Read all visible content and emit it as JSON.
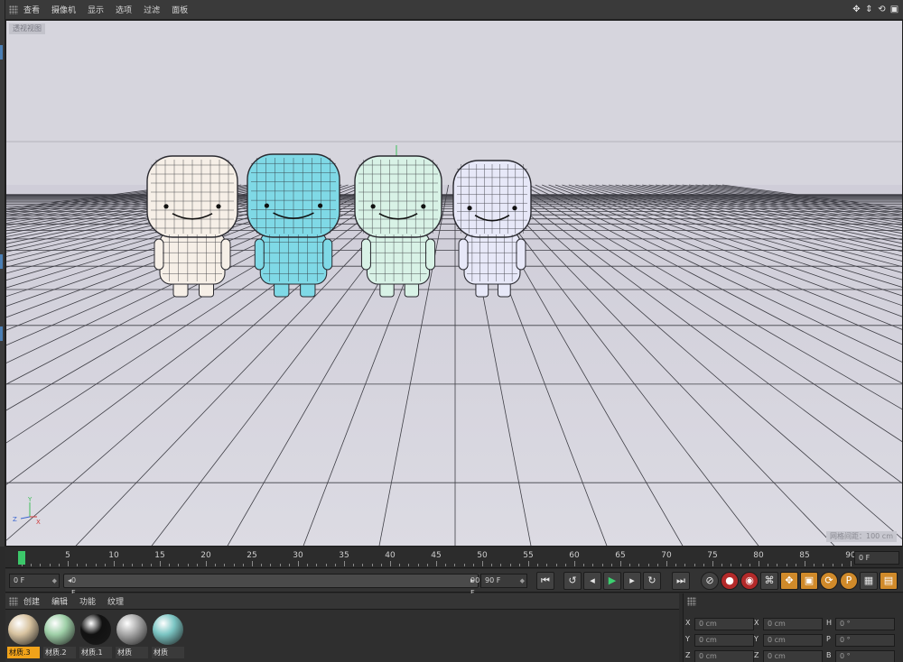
{
  "viewport": {
    "menu": [
      "查看",
      "摄像机",
      "显示",
      "选项",
      "过滤",
      "面板"
    ],
    "label": "透视视图",
    "grid_info": "网格间距：100 cm",
    "nav_icons": [
      "move-view-icon",
      "zoom-view-icon",
      "rotate-view-icon",
      "toggle-view-icon"
    ],
    "axis": {
      "x": "X",
      "y": "Y",
      "z": "Z"
    }
  },
  "timeline": {
    "ticks": [
      0,
      5,
      10,
      15,
      20,
      25,
      30,
      35,
      40,
      45,
      50,
      55,
      60,
      65,
      70,
      75,
      80,
      85,
      90
    ],
    "current_frame": 0,
    "end_field": "0 F"
  },
  "transport": {
    "start_field": "0 F",
    "range_start": "0 F",
    "range_end": "90 F",
    "end_field": "90 F",
    "buttons": [
      "go-start",
      "prev-key",
      "prev-frame",
      "play",
      "next-frame",
      "next-key",
      "go-end",
      "record-off",
      "record-keys",
      "auto-key",
      "key-selection",
      "position-key",
      "scale-key",
      "rotation-key",
      "param-key",
      "pla-key",
      "motion-clips"
    ]
  },
  "materials": {
    "menu": [
      "创建",
      "编辑",
      "功能",
      "纹理"
    ],
    "items": [
      {
        "name": "材质.3",
        "color": "#d8c3a0",
        "selected": true
      },
      {
        "name": "材质.2",
        "color": "#9fd0a8",
        "selected": false
      },
      {
        "name": "材质.1",
        "color": "#111111",
        "selected": false
      },
      {
        "name": "材质",
        "color": "#a9a9a9",
        "selected": false
      },
      {
        "name": "材质",
        "color": "#7cc6c4",
        "selected": false
      }
    ]
  },
  "coordinates": {
    "rows": [
      {
        "a": "X",
        "av": "0 cm",
        "b": "X",
        "bv": "0 cm",
        "c": "H",
        "cv": "0 °"
      },
      {
        "a": "Y",
        "av": "0 cm",
        "b": "Y",
        "bv": "0 cm",
        "c": "P",
        "cv": "0 °"
      },
      {
        "a": "Z",
        "av": "0 cm",
        "b": "Z",
        "bv": "0 cm",
        "c": "B",
        "cv": "0 °"
      }
    ]
  },
  "scene": {
    "characters": [
      {
        "name": "character-1",
        "color": "#f6efe7",
        "selected": false
      },
      {
        "name": "character-2",
        "color": "#7fd9e6",
        "selected": true
      },
      {
        "name": "character-3",
        "color": "#d8f2e6",
        "selected": false
      },
      {
        "name": "character-4",
        "color": "#e7e8f8",
        "selected": false
      }
    ]
  }
}
